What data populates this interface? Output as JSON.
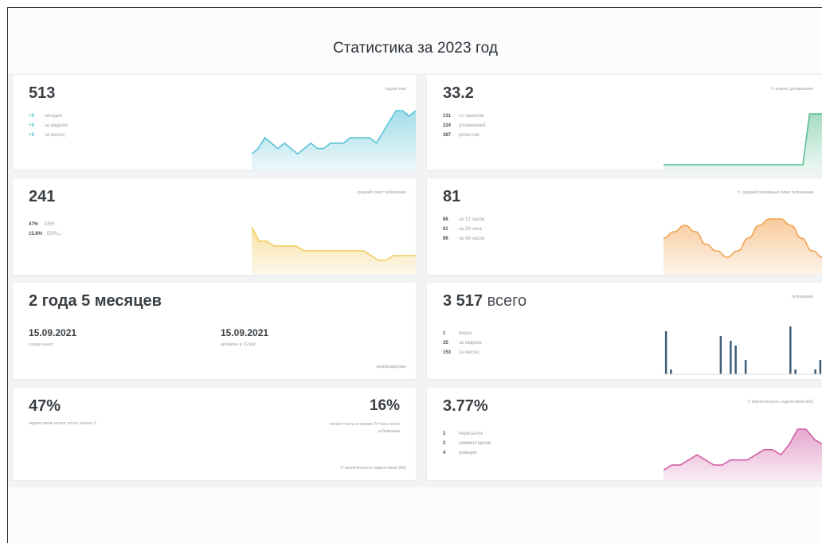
{
  "title": "Статистика за 2023 год",
  "colors": {
    "teal": "#59c2d6",
    "green": "#5bbf93",
    "yellow": "#f0c95a",
    "orange": "#f2a04d",
    "navy": "#3e5d78",
    "pink": "#d15fa6"
  },
  "cards": {
    "subscribers": {
      "value": "513",
      "tag": "подписчики",
      "stats": [
        {
          "n": "+5",
          "label": "сегодня"
        },
        {
          "n": "+9",
          "label": "за неделю"
        },
        {
          "n": "+9",
          "label": "за месяц"
        }
      ]
    },
    "citation": {
      "value": "33.2",
      "tag": "① индекс цитирования",
      "stats": [
        {
          "n": "131",
          "label": "ст. каналов"
        },
        {
          "n": "224",
          "label": "упоминаний"
        },
        {
          "n": "387",
          "label": "репостов"
        }
      ]
    },
    "avg_reach": {
      "value": "241",
      "tag": "средний охват публикации",
      "stats": [
        {
          "n": "47%",
          "label": "ERR"
        },
        {
          "n": "15.8%",
          "label": "ERR₂₄"
        }
      ]
    },
    "ad_reach": {
      "value": "81",
      "tag": "① средний рекламный охват публикации",
      "stats": [
        {
          "n": "86",
          "label": "за 12 часов"
        },
        {
          "n": "81",
          "label": "за 24 часа"
        },
        {
          "n": "86",
          "label": "за 48 часов"
        }
      ]
    },
    "age": {
      "value": "2 года 5 месяцев",
      "date1": "15.09.2021",
      "date1_label": "создан канал",
      "date2": "15.09.2021",
      "date2_label": "добавлен в TGStat",
      "footer": "верифицирован"
    },
    "posts": {
      "value": "3 517",
      "unit": " всего",
      "tag": "публикации",
      "stats": [
        {
          "n": "1",
          "label": "вчера"
        },
        {
          "n": "35",
          "label": "за неделю"
        },
        {
          "n": "153",
          "label": "за месяц"
        }
      ]
    },
    "engagement": {
      "value": "47%",
      "desc": "подписчиков читают посты канала ①",
      "right_value": "16%",
      "right_desc": "читают посты в первые 24 часа после публикации",
      "footer": "① вовлечённость подписчиков (ER)"
    },
    "er": {
      "value": "3.77%",
      "tag": "① вовлечённость подписчиков (ER)",
      "stats": [
        {
          "n": "2",
          "label": "пересылок"
        },
        {
          "n": "2",
          "label": "комментариев"
        },
        {
          "n": "4",
          "label": "реакции"
        }
      ]
    }
  },
  "chart_data": [
    {
      "type": "area",
      "series": [
        {
          "values": [
            2,
            3,
            5,
            4,
            3,
            4,
            3,
            2,
            3,
            4,
            3,
            3,
            4,
            4,
            4,
            5,
            5,
            5,
            5,
            4,
            6,
            8,
            10,
            10,
            9,
            10
          ]
        }
      ]
    },
    {
      "type": "area",
      "series": [
        {
          "values": [
            0,
            0,
            0,
            0,
            0,
            0,
            0,
            0,
            0,
            0,
            0,
            0,
            0,
            0,
            0,
            0,
            0,
            0,
            0,
            0,
            0,
            0,
            10,
            10,
            10
          ]
        }
      ]
    },
    {
      "type": "area",
      "series": [
        {
          "values": [
            9,
            6,
            6,
            5,
            5,
            5,
            5,
            4,
            4,
            4,
            4,
            4,
            4,
            4,
            4,
            4,
            3,
            2,
            2,
            3,
            3,
            3,
            3
          ]
        }
      ]
    },
    {
      "type": "area",
      "series": [
        {
          "values": [
            5,
            6,
            7,
            6,
            4,
            3,
            2,
            3,
            5,
            7,
            8,
            8,
            7,
            5,
            3,
            2
          ]
        }
      ]
    },
    {
      "type": "bar",
      "values": [
        9,
        1,
        0,
        0,
        0,
        0,
        0,
        0,
        0,
        0,
        0,
        8,
        0,
        7,
        6,
        0,
        3,
        0,
        0,
        0,
        0,
        0,
        0,
        0,
        0,
        10,
        1,
        0,
        0,
        0,
        1,
        3
      ]
    },
    {
      "type": "area",
      "series": [
        {
          "values": [
            1,
            2,
            2,
            3,
            4,
            3,
            2,
            2,
            3,
            3,
            3,
            4,
            5,
            5,
            4,
            6,
            9,
            9,
            7,
            6
          ]
        }
      ]
    }
  ]
}
